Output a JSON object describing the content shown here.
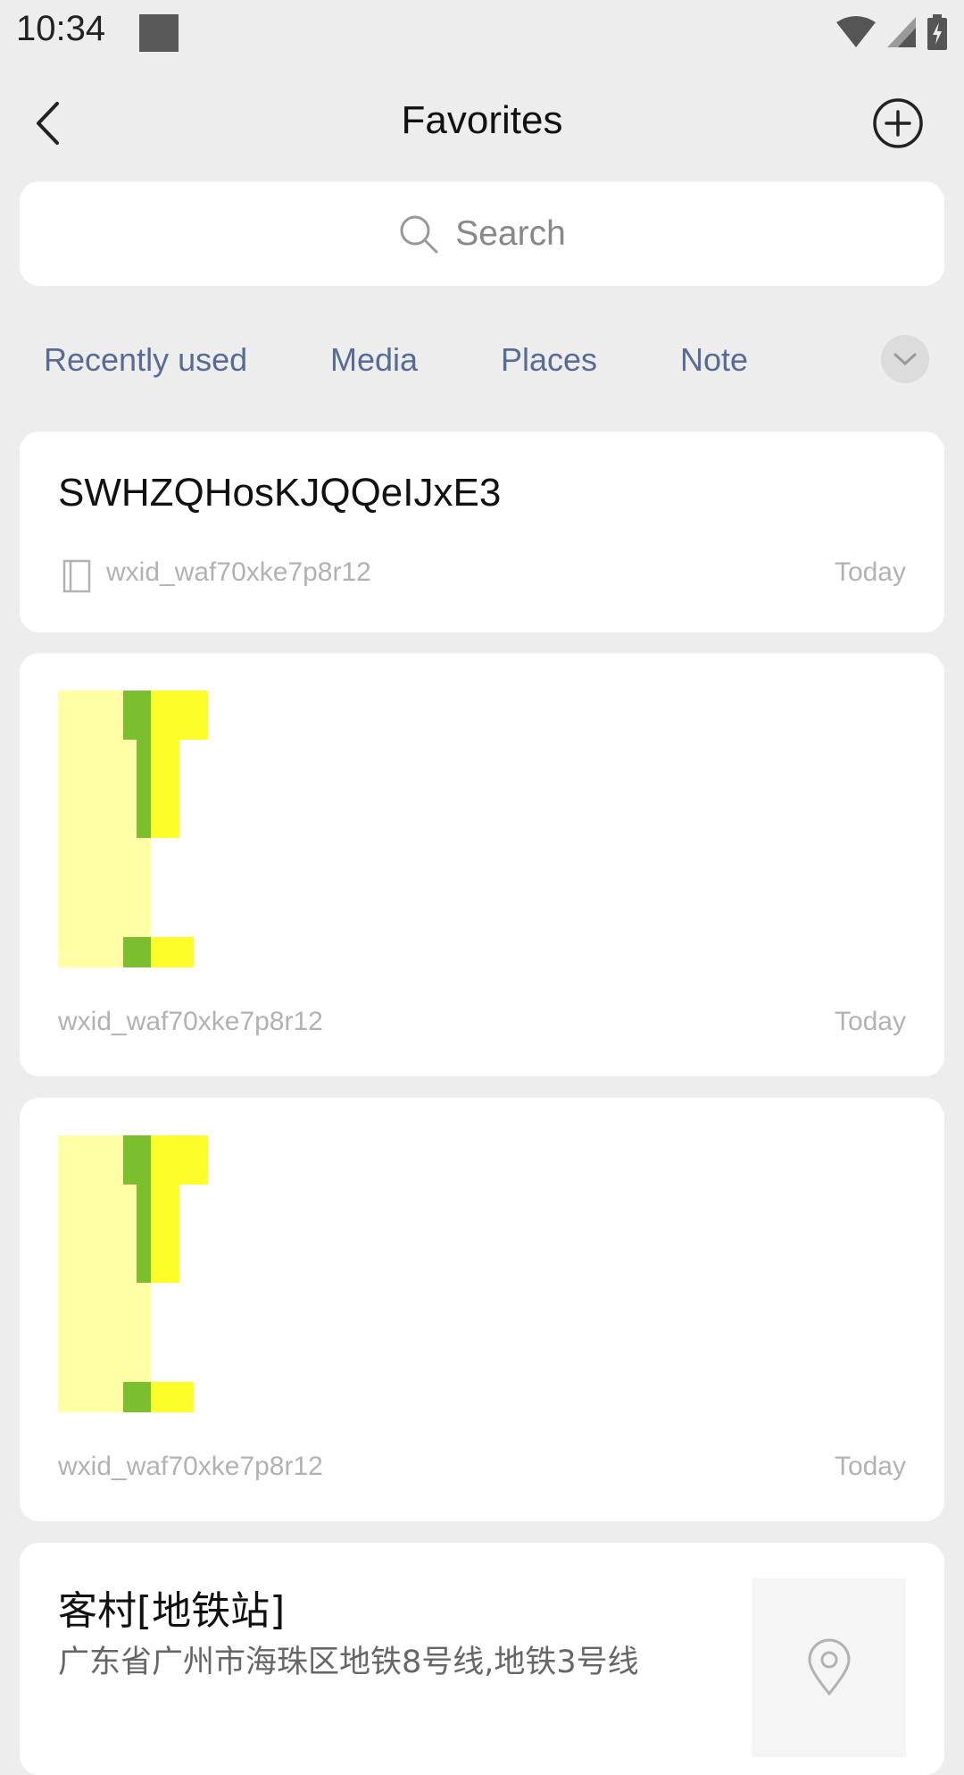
{
  "status_bar": {
    "time": "10:34"
  },
  "header": {
    "title": "Favorites",
    "back_icon": "chevron-left-icon",
    "add_icon": "plus-circle-icon"
  },
  "search": {
    "placeholder": "Search"
  },
  "filters": {
    "tabs": [
      "Recently used",
      "Media",
      "Places",
      "Note"
    ]
  },
  "items": [
    {
      "type": "note",
      "title": "SWHZQHosKJQQeIJxE3",
      "source": "wxid_waf70xke7p8r12",
      "time": "Today"
    },
    {
      "type": "image",
      "source": "wxid_waf70xke7p8r12",
      "time": "Today"
    },
    {
      "type": "image",
      "source": "wxid_waf70xke7p8r12",
      "time": "Today"
    },
    {
      "type": "location",
      "title": "客村[地铁站]",
      "address": "广东省广州市海珠区地铁8号线,地铁3号线"
    }
  ],
  "colors": {
    "link": "#576b95",
    "background": "#ededed",
    "card": "#ffffff",
    "meta": "#b2b2b2"
  }
}
